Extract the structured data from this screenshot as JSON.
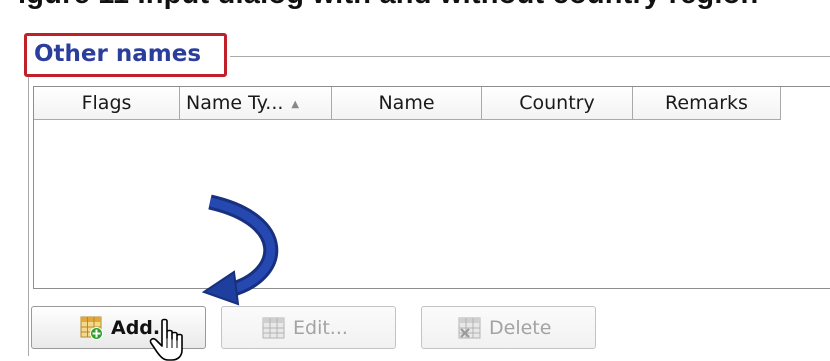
{
  "caption_fragment": "igure 11 Input dialog with and without country region",
  "group": {
    "title": "Other names"
  },
  "table": {
    "columns": [
      {
        "label": "Flags"
      },
      {
        "label": "Name Ty..."
      },
      {
        "label": "Name"
      },
      {
        "label": "Country"
      },
      {
        "label": "Remarks"
      }
    ],
    "rows": []
  },
  "buttons": {
    "add": "Add...",
    "edit": "Edit...",
    "delete": "Delete"
  },
  "colors": {
    "group_title": "#2b3e9c",
    "highlight_box": "#c0202a",
    "arrow": "#1f3f9e"
  },
  "icons": {
    "sort": "sort-asc-icon",
    "add": "table-add-icon",
    "edit": "table-edit-icon",
    "delete": "table-delete-icon",
    "annotation_arrow": "curved-arrow-icon",
    "cursor": "hand-pointer-icon"
  }
}
